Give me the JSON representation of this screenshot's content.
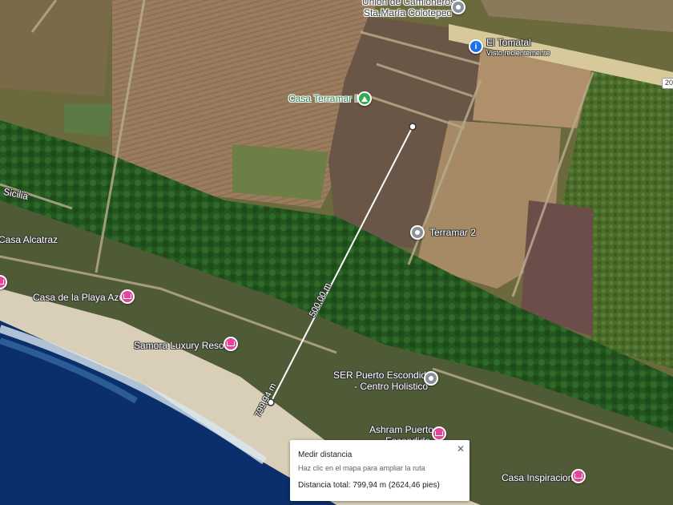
{
  "places": {
    "union_line1": "Unión de Camioneros",
    "union_line2": "Sta.María Colotepec",
    "tomatal": "El Tomatal",
    "tomatal_sub": "Visto recientemente",
    "casa_terramar": "Casa Terramar II",
    "terramar2": "Terramar 2",
    "sicilia": "Sicilia",
    "casa_alcatraz": "Casa Alcatraz",
    "casa_playa_azul": "Casa de la Playa Azul",
    "samora": "Samora Luxury Resort",
    "ser_line1": "SER Puerto Escondido",
    "ser_line2": "- Centro Holistico",
    "ashram_line1": "Ashram Puerto",
    "ashram_line2": "Escondido",
    "casa_inspiracion": "Casa Inspiracion"
  },
  "road_number": "20",
  "measure": {
    "segment_label": "500,00 m",
    "end_label": "799,94 m"
  },
  "card": {
    "title": "Medir distancia",
    "hint": "Haz clic en el mapa para ampliar la ruta",
    "total": "Distancia total: 799,94 m (2624,46 pies)",
    "close": "✕"
  },
  "colors": {
    "grey_pin": "#8a9199",
    "hotel_pin": "#e04799",
    "blue_pin": "#1a73e8",
    "green_pin": "#34a853",
    "ocean": "#0b2f6b",
    "sand": "#d9cfb8"
  }
}
